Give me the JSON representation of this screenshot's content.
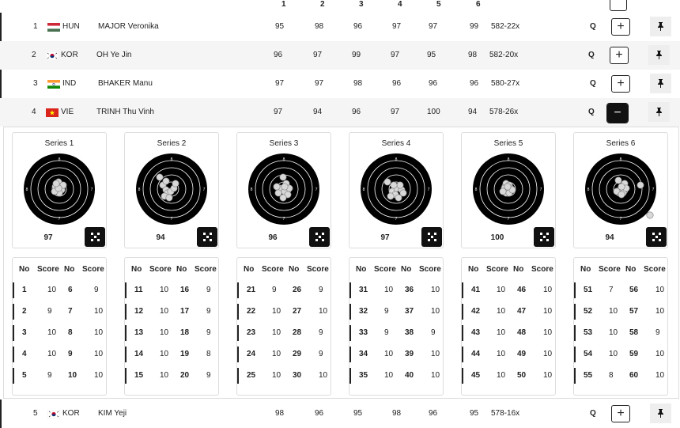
{
  "header": {
    "series_cols": [
      "1",
      "2",
      "3",
      "4",
      "5",
      "6"
    ]
  },
  "athletes": [
    {
      "rank": "1",
      "nation": "HUN",
      "name": "MAJOR Veronika",
      "series": [
        "95",
        "98",
        "96",
        "97",
        "97",
        "99"
      ],
      "total": "582-22x",
      "q": "Q",
      "expand": "+"
    },
    {
      "rank": "2",
      "nation": "KOR",
      "name": "OH Ye Jin",
      "series": [
        "96",
        "97",
        "99",
        "97",
        "95",
        "98"
      ],
      "total": "582-20x",
      "q": "Q",
      "expand": "+"
    },
    {
      "rank": "3",
      "nation": "IND",
      "name": "BHAKER Manu",
      "series": [
        "97",
        "97",
        "98",
        "96",
        "96",
        "96"
      ],
      "total": "580-27x",
      "q": "Q",
      "expand": "+"
    },
    {
      "rank": "4",
      "nation": "VIE",
      "name": "TRINH Thu Vinh",
      "series": [
        "97",
        "94",
        "96",
        "97",
        "100",
        "94"
      ],
      "total": "578-26x",
      "q": "Q",
      "expand": "−"
    },
    {
      "rank": "5",
      "nation": "KOR",
      "name": "KIM Yeji",
      "series": [
        "98",
        "96",
        "95",
        "98",
        "96",
        "95"
      ],
      "total": "578-16x",
      "q": "Q",
      "expand": "+"
    }
  ],
  "detail": {
    "table_headers": [
      "No",
      "Score",
      "No",
      "Score"
    ],
    "target_ring_numbers": [
      "8",
      "7",
      "8",
      "7"
    ],
    "series": [
      {
        "title": "Series 1",
        "total": "97",
        "shots": [
          [
            "1",
            "10"
          ],
          [
            "2",
            "9"
          ],
          [
            "3",
            "10"
          ],
          [
            "4",
            "10"
          ],
          [
            "5",
            "9"
          ],
          [
            "6",
            "9"
          ],
          [
            "7",
            "10"
          ],
          [
            "8",
            "10"
          ],
          [
            "9",
            "10"
          ],
          [
            "10",
            "10"
          ]
        ]
      },
      {
        "title": "Series 2",
        "total": "94",
        "shots": [
          [
            "11",
            "10"
          ],
          [
            "12",
            "10"
          ],
          [
            "13",
            "10"
          ],
          [
            "14",
            "10"
          ],
          [
            "15",
            "10"
          ],
          [
            "16",
            "9"
          ],
          [
            "17",
            "9"
          ],
          [
            "18",
            "9"
          ],
          [
            "19",
            "8"
          ],
          [
            "20",
            "9"
          ]
        ]
      },
      {
        "title": "Series 3",
        "total": "96",
        "shots": [
          [
            "21",
            "9"
          ],
          [
            "22",
            "10"
          ],
          [
            "23",
            "10"
          ],
          [
            "24",
            "10"
          ],
          [
            "25",
            "10"
          ],
          [
            "26",
            "9"
          ],
          [
            "27",
            "10"
          ],
          [
            "28",
            "9"
          ],
          [
            "29",
            "9"
          ],
          [
            "30",
            "10"
          ]
        ]
      },
      {
        "title": "Series 4",
        "total": "97",
        "shots": [
          [
            "31",
            "10"
          ],
          [
            "32",
            "9"
          ],
          [
            "33",
            "9"
          ],
          [
            "34",
            "10"
          ],
          [
            "35",
            "10"
          ],
          [
            "36",
            "10"
          ],
          [
            "37",
            "10"
          ],
          [
            "38",
            "9"
          ],
          [
            "39",
            "10"
          ],
          [
            "40",
            "10"
          ]
        ]
      },
      {
        "title": "Series 5",
        "total": "100",
        "shots": [
          [
            "41",
            "10"
          ],
          [
            "42",
            "10"
          ],
          [
            "43",
            "10"
          ],
          [
            "44",
            "10"
          ],
          [
            "45",
            "10"
          ],
          [
            "46",
            "10"
          ],
          [
            "47",
            "10"
          ],
          [
            "48",
            "10"
          ],
          [
            "49",
            "10"
          ],
          [
            "50",
            "10"
          ]
        ]
      },
      {
        "title": "Series 6",
        "total": "94",
        "shots": [
          [
            "51",
            "7"
          ],
          [
            "52",
            "10"
          ],
          [
            "53",
            "10"
          ],
          [
            "54",
            "10"
          ],
          [
            "55",
            "8"
          ],
          [
            "56",
            "10"
          ],
          [
            "57",
            "10"
          ],
          [
            "58",
            "9"
          ],
          [
            "59",
            "10"
          ],
          [
            "60",
            "10"
          ]
        ]
      }
    ]
  },
  "icons": {
    "expand": "expand-icon",
    "pin": "pin-icon",
    "plus": "plus-icon",
    "minus": "minus-icon"
  }
}
